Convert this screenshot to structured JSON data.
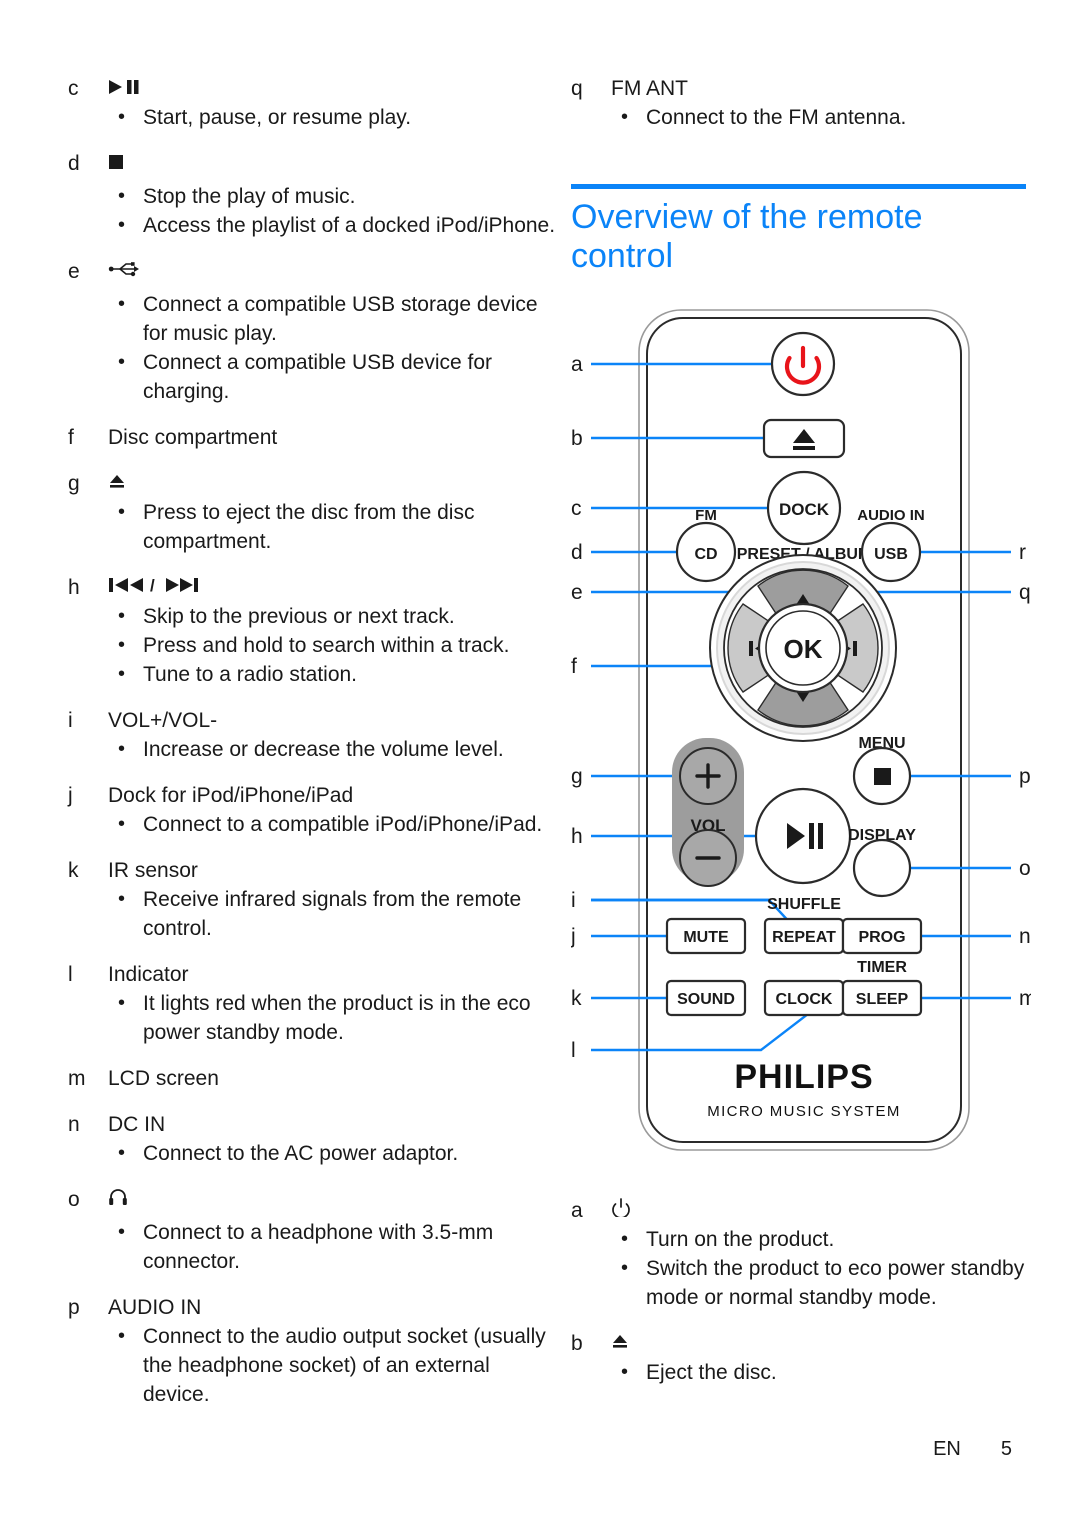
{
  "colors": {
    "accent_blue": "#0b84f8",
    "power_red": "#e8141a",
    "text": "#1a1a1a",
    "dpad_dark": "#9d9d9d",
    "dpad_light": "#c9c9c9",
    "vol_pad": "#9d9d9d"
  },
  "left_column": {
    "entries": [
      {
        "letter": "c",
        "title": "▶⏸",
        "symbol": true,
        "bullets": [
          "Start, pause, or resume play."
        ]
      },
      {
        "letter": "d",
        "title": "■",
        "symbol": true,
        "bullets": [
          "Stop the play of music.",
          "Access the playlist of a docked iPod/iPhone."
        ]
      },
      {
        "letter": "e",
        "title": "USB",
        "symbol": true,
        "bullets": [
          "Connect a compatible USB storage device for music play.",
          "Connect a compatible USB device for charging."
        ]
      },
      {
        "letter": "f",
        "title": "Disc compartment",
        "symbol": false,
        "bullets": []
      },
      {
        "letter": "g",
        "title": "⏏",
        "symbol": true,
        "bullets": [
          "Press to eject the disc from the disc compartment."
        ]
      },
      {
        "letter": "h",
        "title": "⏮⏮ / ⏭⏭",
        "symbol": true,
        "bullets": [
          "Skip to the previous or next track.",
          "Press and hold to search within a track.",
          "Tune to a radio station."
        ]
      },
      {
        "letter": "i",
        "title": "VOL+/VOL-",
        "symbol": false,
        "bullets": [
          "Increase or decrease the volume level."
        ]
      },
      {
        "letter": "j",
        "title": "Dock for iPod/iPhone/iPad",
        "symbol": false,
        "bullets": [
          "Connect to a compatible iPod/iPhone/iPad."
        ]
      },
      {
        "letter": "k",
        "title": "IR sensor",
        "symbol": false,
        "bullets": [
          "Receive infrared signals from the remote control."
        ]
      },
      {
        "letter": "l",
        "title": "Indicator",
        "symbol": false,
        "bullets": [
          "It lights red when the product is in the eco power standby mode."
        ]
      },
      {
        "letter": "m",
        "title": "LCD screen",
        "symbol": false,
        "bullets": []
      },
      {
        "letter": "n",
        "title": "DC IN",
        "symbol": false,
        "bullets": [
          "Connect to the AC power adaptor."
        ]
      },
      {
        "letter": "o",
        "title": "🎧",
        "symbol": true,
        "bullets": [
          "Connect to a headphone with 3.5-mm connector."
        ]
      },
      {
        "letter": "p",
        "title": "AUDIO IN",
        "symbol": false,
        "bullets": [
          "Connect to the audio output socket (usually the headphone socket) of an external device."
        ]
      }
    ]
  },
  "right_column": {
    "entries_top": [
      {
        "letter": "q",
        "title": "FM ANT",
        "symbol": false,
        "bullets": [
          "Connect to the FM antenna."
        ]
      }
    ],
    "heading": "Overview of the remote control",
    "entries_bottom": [
      {
        "letter": "a",
        "title": "⏻",
        "symbol": true,
        "bullets": [
          "Turn on the product.",
          "Switch the product to eco power standby mode or normal standby mode."
        ]
      },
      {
        "letter": "b",
        "title": "⏏",
        "symbol": true,
        "bullets": [
          "Eject the disc."
        ]
      }
    ]
  },
  "remote": {
    "brand": "PHILIPS",
    "tagline": "MICRO MUSIC SYSTEM",
    "buttons": {
      "power": "power-icon",
      "eject": "eject-icon",
      "dock": "DOCK",
      "fm_label": "FM",
      "cd": "CD",
      "preset_album": "PRESET / ALBUM",
      "audio_in_label": "AUDIO IN",
      "usb": "USB",
      "ok": "OK",
      "prev": "⏮",
      "next": "⏭",
      "up": "▲",
      "down": "▼",
      "vol": "VOL",
      "vol_plus": "+",
      "vol_minus": "−",
      "play_pause": "▶❙❙",
      "menu_label": "MENU",
      "stop": "■",
      "display": "DISPLAY",
      "shuffle_label": "SHUFFLE",
      "mute": "MUTE",
      "repeat": "REPEAT",
      "prog": "PROG",
      "timer_label": "TIMER",
      "sound": "SOUND",
      "clock": "CLOCK",
      "sleep": "SLEEP"
    },
    "callouts_left": [
      "a",
      "b",
      "c",
      "d",
      "e",
      "f",
      "g",
      "h",
      "i",
      "j",
      "k",
      "l"
    ],
    "callouts_right": [
      "r",
      "q",
      "p",
      "o",
      "n",
      "m"
    ]
  },
  "footer": {
    "language": "EN",
    "page_number": "5"
  }
}
